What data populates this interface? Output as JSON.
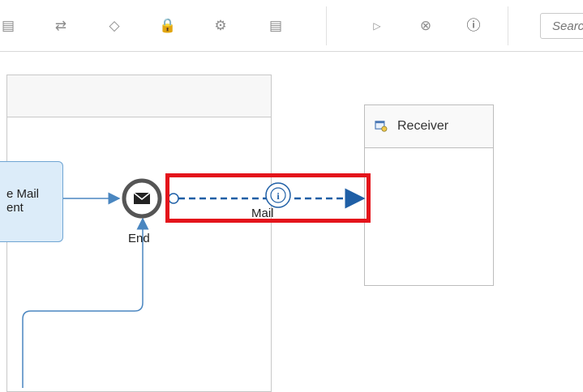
{
  "toolbar": {
    "icons": [
      "clipboard-icon",
      "swap-arrows-icon",
      "diamond-icon",
      "lock-icon",
      "gear-icon",
      "checklist-icon",
      "play-icon",
      "cancel-icon",
      "help-icon"
    ],
    "search_placeholder": "Search"
  },
  "diagram": {
    "task_label": "e Mail\nent",
    "end_event_label": "End",
    "message_flow_label": "Mail",
    "receiver_title": "Receiver"
  },
  "colors": {
    "accent_blue": "#1f5fa6",
    "task_fill": "#dcecf9",
    "highlight_red": "#e4141b"
  }
}
